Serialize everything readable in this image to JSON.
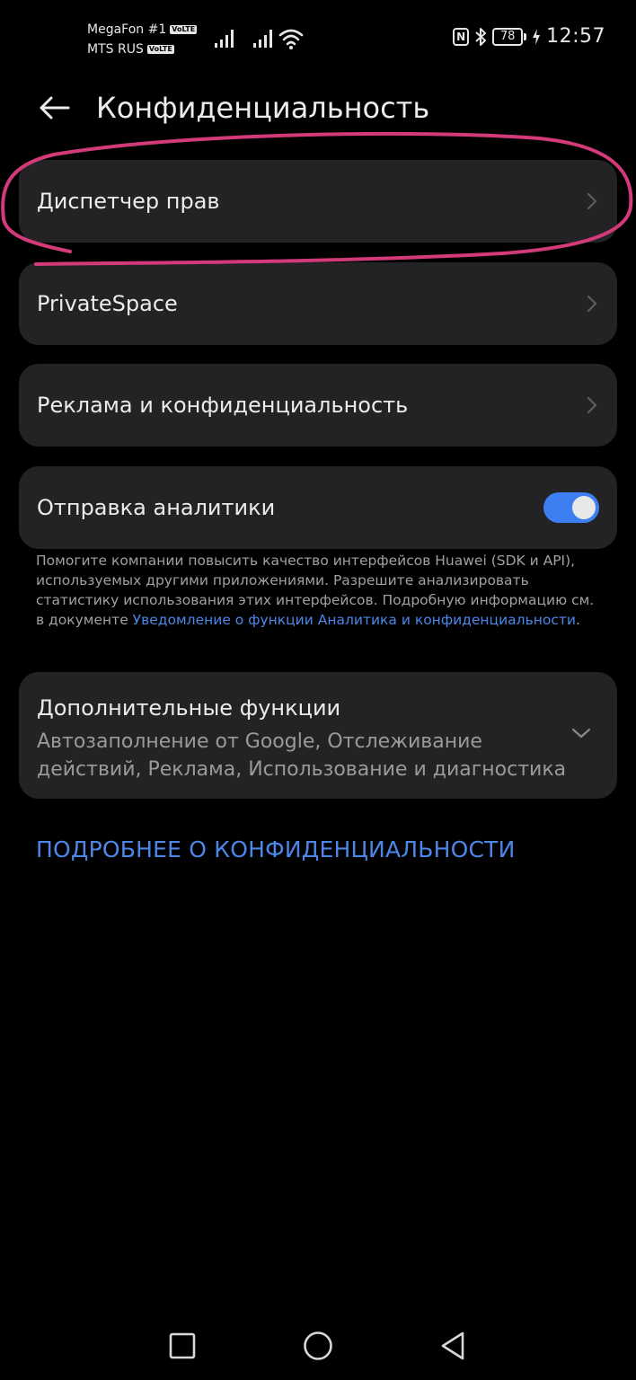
{
  "status_bar": {
    "carrier_1": "MegaFon #1",
    "carrier_2": "MTS RUS",
    "volte_label": "VoLTE",
    "nfc_label": "N",
    "battery": "78",
    "time": "12:57",
    "icons": [
      "signal-icon",
      "signal-icon",
      "wifi-icon",
      "nfc-icon",
      "bluetooth-icon",
      "battery-icon",
      "charging-icon"
    ]
  },
  "header": {
    "title": "Конфиденциальность",
    "back_icon": "arrow-left-icon"
  },
  "items": [
    {
      "label": "Диспетчер прав",
      "icon": "chevron-right-icon"
    },
    {
      "label": "PrivateSpace",
      "icon": "chevron-right-icon"
    },
    {
      "label": "Реклама и конфиденциальность",
      "icon": "chevron-right-icon"
    },
    {
      "label": "Отправка аналитики",
      "toggle_on": true
    }
  ],
  "analytics_description": {
    "text": "Помогите компании повысить качество интерфейсов Huawei (SDK и API), используемых другими приложениями. Разрешите анализировать статистику использования этих интерфейсов. Подробную информацию см. в документе ",
    "link": "Уведомление о функции Аналитика и конфиденциальности",
    "after": "."
  },
  "extra": {
    "title": "Дополнительные функции",
    "subtitle": "Автозаполнение от Google, Отслеживание действий, Реклама, Использование и диагностика",
    "icon": "chevron-down-icon"
  },
  "more_link": "ПОДРОБНЕЕ О КОНФИДЕНЦИАЛЬНОСТИ",
  "colors": {
    "background": "#000000",
    "card": "#232325",
    "accent": "#4c86e8",
    "toggle": "#3d7ff0",
    "annotation": "#d23a7a"
  },
  "nav_bar": {
    "icons": [
      "recents-square-icon",
      "home-circle-icon",
      "back-triangle-icon"
    ]
  }
}
